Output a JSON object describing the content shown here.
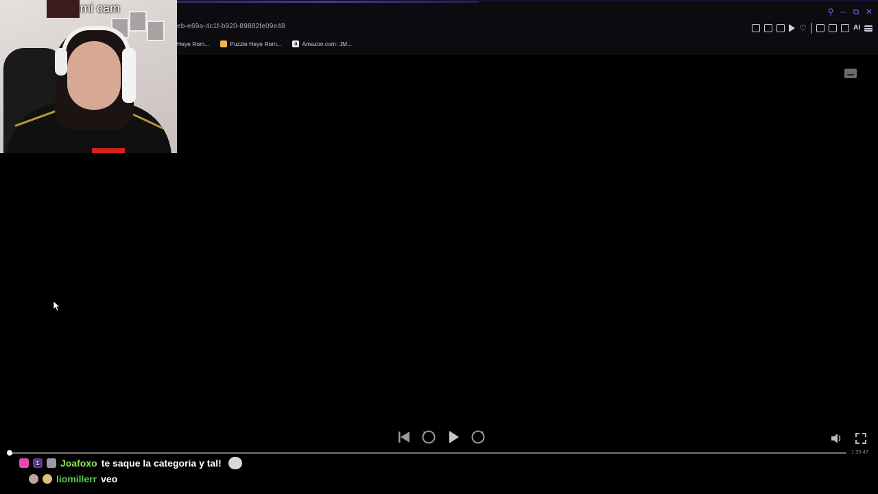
{
  "browser": {
    "url_fragment": "eb-e69a-4c1f-b920-89882fe09e48",
    "bookmarks": [
      {
        "label": "Heye Rom...",
        "icon": "none"
      },
      {
        "label": "Puzzle Heye Rom...",
        "icon": "puzzle-icon"
      },
      {
        "label": "Amazon.com: JM...",
        "icon": "amazon-icon"
      }
    ],
    "toolbar_ai_label": "AI"
  },
  "webcam": {
    "label": "mi cam"
  },
  "player": {
    "time": "1:35:47",
    "progress": 0.0
  },
  "chat": [
    {
      "user": "Joafoxo",
      "message": "te saque la categoria y tal!",
      "badges": [
        "heart-badge",
        "sub-badge-1",
        "grey-badge"
      ],
      "user_color": "#90e560"
    },
    {
      "user": "liomillerr",
      "message": "veo",
      "badges": [
        "cat-badge",
        "gold-badge"
      ],
      "user_color": "#4fd24a"
    }
  ],
  "colors": {
    "accent": "#8a5cff",
    "background": "#000000"
  }
}
